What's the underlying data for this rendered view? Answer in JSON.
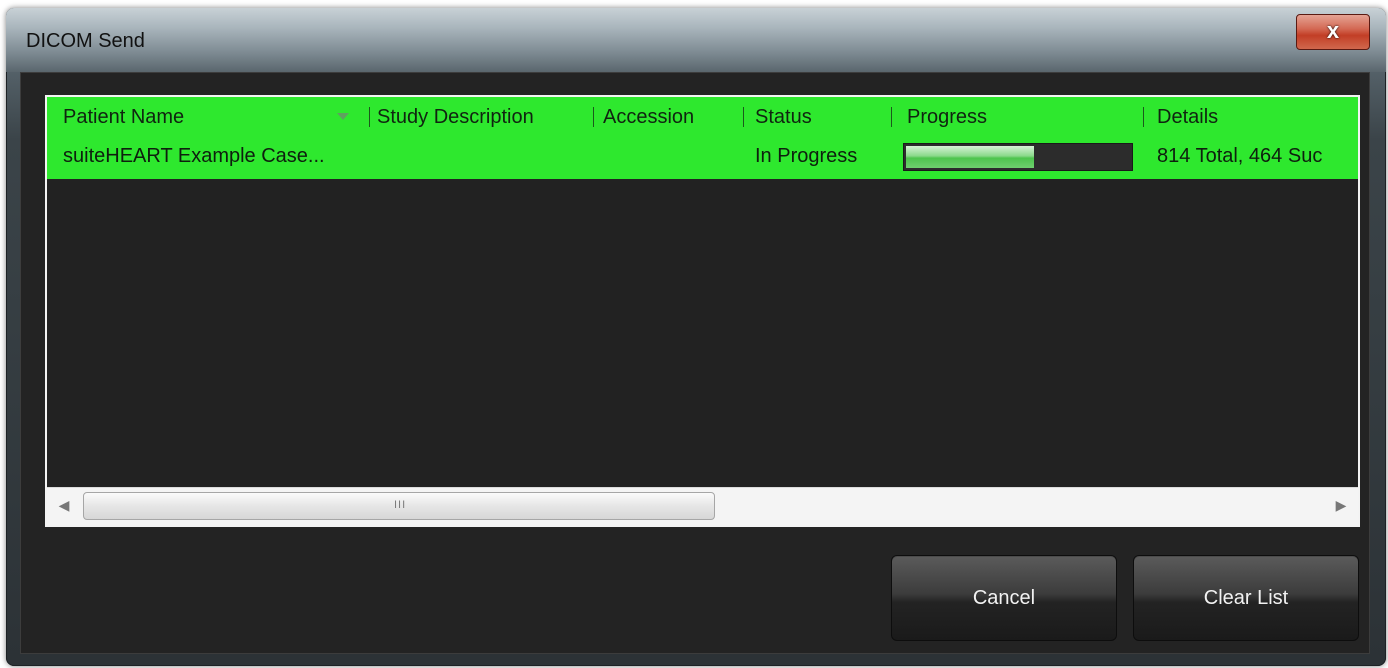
{
  "window": {
    "title": "DICOM Send",
    "close_glyph": "x"
  },
  "columns": [
    {
      "label": "Patient Name"
    },
    {
      "label": "Study Description"
    },
    {
      "label": "Accession"
    },
    {
      "label": "Status"
    },
    {
      "label": "Progress"
    },
    {
      "label": "Details"
    }
  ],
  "rows": [
    {
      "patient_name": "suiteHEART Example Case...",
      "study_description": "",
      "accession": "",
      "status": "In Progress",
      "progress_fraction": 0.57,
      "details": "814 Total, 464 Suc"
    }
  ],
  "scrollbar": {
    "grip": "III"
  },
  "buttons": {
    "cancel": "Cancel",
    "clear_list": "Clear List"
  },
  "colors": {
    "row_highlight": "#2ee82e",
    "background": "#232323"
  },
  "icons": {
    "close": "close-icon",
    "sort": "sort-down-icon",
    "scroll_left": "scroll-left-icon",
    "scroll_right": "scroll-right-icon"
  }
}
